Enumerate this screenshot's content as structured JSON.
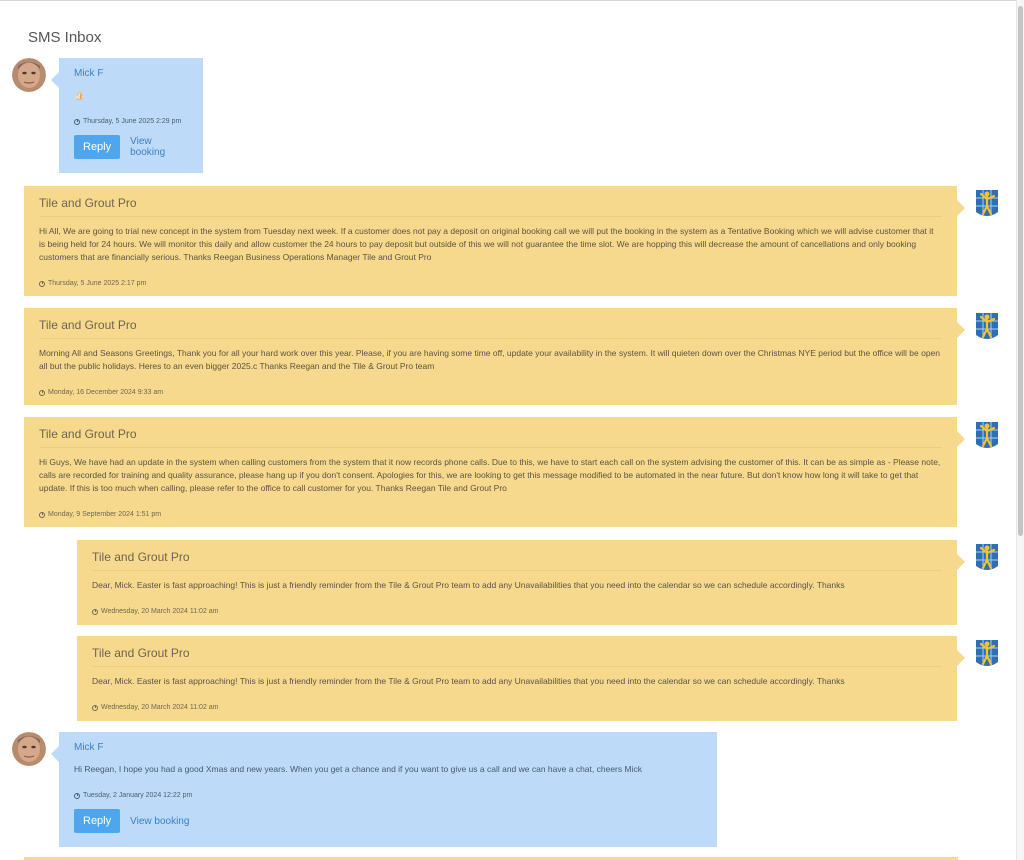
{
  "inbox": {
    "title": "SMS Inbox"
  },
  "messages": [
    {
      "sender": "Mick F",
      "body": "👍🏻",
      "timestamp": "Thursday, 5 June 2025 2:29 pm",
      "reply_label": "Reply",
      "view_label": "View booking"
    },
    {
      "sender": "Tile and Grout Pro",
      "body": "Hi All, We are going to trial new concept in the system from Tuesday next week. If a customer does not pay a deposit on original booking call we will put the booking in the system as a Tentative Booking which we will advise customer that it is being held for 24 hours. We will monitor this daily and allow customer the 24 hours to pay deposit but outside of this we will not guarantee the time slot. We are hopping this will decrease the amount of cancellations and only booking customers that are financially serious. Thanks Reegan Business Operations Manager Tile and Grout Pro",
      "timestamp": "Thursday, 5 June 2025 2:17 pm"
    },
    {
      "sender": "Tile and Grout Pro",
      "body": "Morning All and Seasons Greetings, Thank you for all your hard work over this year. Please, if you are having some time off, update your availability in the system. It will quieten down over the Christmas NYE period but the office will be open all but the public holidays. Heres to an even bigger 2025.c Thanks Reegan and the Tile & Grout Pro team",
      "timestamp": "Monday, 16 December 2024 9:33 am"
    },
    {
      "sender": "Tile and Grout Pro",
      "body": "Hi Guys, We have had an update in the system when calling customers from the system that it now records phone calls. Due to this, we have to start each call on the system advising the customer of this. It can be as simple as - Please note, calls are recorded for training and quality assurance, please hang up if you don't consent. Apologies for this, we are looking to get this message modified to be automated in the near future. But don't know how long it will take to get that update. If this is too much when calling, please refer to the office to call customer for you. Thanks Reegan Tile and Grout Pro",
      "timestamp": "Monday, 9 September 2024 1:51 pm"
    },
    {
      "sender": "Tile and Grout Pro",
      "body": "Dear, Mick. Easter is fast approaching! This is just a friendly reminder from the Tile & Grout Pro team to add any Unavailabilities that you need into the calendar so we can schedule accordingly. Thanks",
      "timestamp": "Wednesday, 20 March 2024 11:02 am"
    },
    {
      "sender": "Tile and Grout Pro",
      "body": "Dear, Mick. Easter is fast approaching! This is just a friendly reminder from the Tile & Grout Pro team to add any Unavailabilities that you need into the calendar so we can schedule accordingly. Thanks",
      "timestamp": "Wednesday, 20 March 2024 11:02 am"
    },
    {
      "sender": "Mick F",
      "body": "Hi Reegan, I hope you had a good Xmas and new years. When you get a chance and if you want to give us a call and we can have a chat, cheers Mick",
      "timestamp": "Tuesday, 2 January 2024 12:22 pm",
      "reply_label": "Reply",
      "view_label": "View booking"
    }
  ],
  "icons": {
    "user_avatar": "user-avatar",
    "company_logo": "tile-and-grout-pro-logo-icon",
    "clock": "clock-icon"
  },
  "colors": {
    "incoming_bubble": "#bddbf8",
    "outgoing_bubble": "#f7d98e",
    "reply_button": "#4ea6ee",
    "link": "#3a7fc5"
  }
}
